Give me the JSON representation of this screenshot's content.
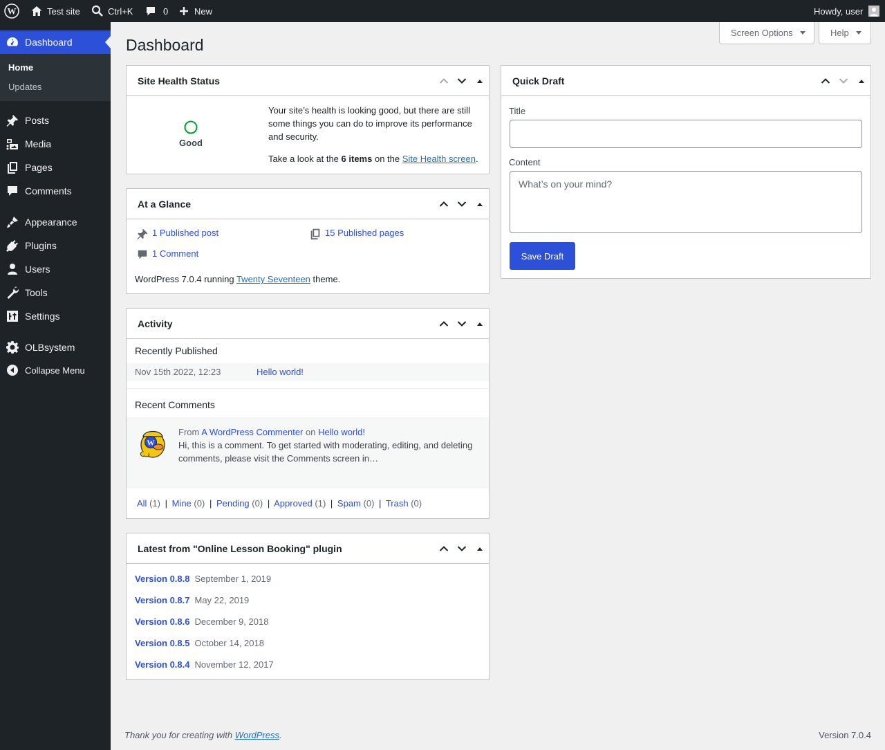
{
  "adminbar": {
    "wp_logo": "wordpress-logo-icon",
    "site_name": "Test site",
    "search_shortcut": "Ctrl+K",
    "comments_count": "0",
    "new_label": "New",
    "howdy": "Howdy, user"
  },
  "sidebar": {
    "dashboard": "Dashboard",
    "submenu": {
      "home": "Home",
      "updates": "Updates"
    },
    "items": [
      {
        "label": "Posts",
        "icon": "pushpin-icon"
      },
      {
        "label": "Media",
        "icon": "media-icon"
      },
      {
        "label": "Pages",
        "icon": "pages-icon"
      },
      {
        "label": "Comments",
        "icon": "comments-icon"
      },
      {
        "label": "Appearance",
        "icon": "paintbrush-icon"
      },
      {
        "label": "Plugins",
        "icon": "plugins-icon"
      },
      {
        "label": "Users",
        "icon": "users-icon"
      },
      {
        "label": "Tools",
        "icon": "wrench-icon"
      },
      {
        "label": "Settings",
        "icon": "settings-icon"
      },
      {
        "label": "OLBsystem",
        "icon": "gear-icon"
      },
      {
        "label": "Collapse Menu",
        "icon": "collapse-icon"
      }
    ]
  },
  "screen_options": "Screen Options",
  "help": "Help",
  "page_title": "Dashboard",
  "site_health": {
    "title": "Site Health Status",
    "status": "Good",
    "message": "Your site’s health is looking good, but there are still some things you can do to improve its performance and security.",
    "look_prefix": "Take a look at the",
    "items_count": "6 items",
    "look_middle": "on the",
    "link": "Site Health screen",
    "period": "."
  },
  "glance": {
    "title": "At a Glance",
    "posts": "1 Published post",
    "pages": "15 Published pages",
    "comments": "1 Comment",
    "running_prefix": "WordPress 7.0.4 running",
    "theme": "Twenty Seventeen",
    "running_suffix": "theme."
  },
  "activity": {
    "title": "Activity",
    "recently_published": "Recently Published",
    "post_date": "Nov 15th 2022, 12:23",
    "post_title": "Hello world!",
    "recent_comments": "Recent Comments",
    "comment_from": "From",
    "comment_author": "A WordPress Commenter",
    "comment_on": "on",
    "comment_post": "Hello world!",
    "comment_text": "Hi, this is a comment. To get started with moderating, editing, and deleting comments, please visit the Comments screen in…",
    "filters": [
      {
        "label": "All",
        "count": "(1)"
      },
      {
        "label": "Mine",
        "count": "(0)"
      },
      {
        "label": "Pending",
        "count": "(0)"
      },
      {
        "label": "Approved",
        "count": "(1)"
      },
      {
        "label": "Spam",
        "count": "(0)"
      },
      {
        "label": "Trash",
        "count": "(0)"
      }
    ],
    "separator": "|"
  },
  "plugin_news": {
    "title": "Latest from \"Online Lesson Booking\" plugin",
    "versions": [
      {
        "version": "Version 0.8.8",
        "date": "September 1, 2019"
      },
      {
        "version": "Version 0.8.7",
        "date": "May 22, 2019"
      },
      {
        "version": "Version 0.8.6",
        "date": "December 9, 2018"
      },
      {
        "version": "Version 0.8.5",
        "date": "October 14, 2018"
      },
      {
        "version": "Version 0.8.4",
        "date": "November 12, 2017"
      }
    ]
  },
  "quick_draft": {
    "title": "Quick Draft",
    "title_label": "Title",
    "title_value": "",
    "content_label": "Content",
    "content_placeholder": "What’s on your mind?",
    "save": "Save Draft"
  },
  "footer": {
    "thanks_prefix": "Thank you for creating with",
    "wp_link": "WordPress",
    "thanks_suffix": ".",
    "version": "Version 7.0.4"
  }
}
